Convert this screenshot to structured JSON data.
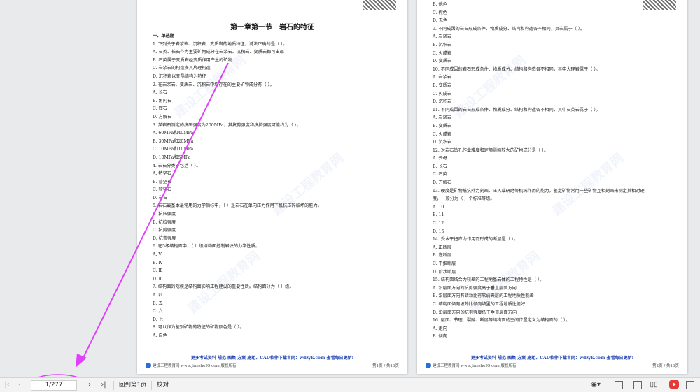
{
  "page1": {
    "title": "第一章第一节　岩石的特征",
    "lines": [
      "一、单选题",
      "1. 下列关于岩浆岩、沉积岩、变质岩的地质特征，说法正确的是（ ）。",
      "A. 石英、长石作为主要矿物成分在岩浆岩、沉积岩、变质岩都可出现",
      "B. 石英属于变质岩经变质作用产生的矿物",
      "C. 岩浆岩的构造多具片理构造",
      "D. 沉积岩以变晶结构为特征",
      "2. 在岩浆岩、变质岩、沉积岩中均存在的主要矿物成分有（ ）。",
      "A. 长石",
      "B. 角闪石",
      "C. 辉石",
      "D. 方解石",
      "3. 某岩石测定的抗压强度为200MPa，其抗剪强度和抗拉强度可能约为（ ）。",
      "A. 60MPa和40MPa",
      "B. 30MPa和20MPa",
      "C. 10MPa和10MPa",
      "D. 10MPa和5MPa",
      "4. 岩石分类不包括（ ）。",
      "A. 特坚石",
      "B. 普坚石",
      "C. 软坚石",
      "D. 岩石",
      "5. 岩石最基本最常用的力学指标中，（ ）是岩石在单向压力作用下抵抗压碎破坏的能力。",
      "A. 抗压强度",
      "B. 抗拉强度",
      "C. 抗剪强度",
      "D. 抗弯强度",
      "6. 在5级结构面中，（ ）级结构面控制岩块的力学性质。",
      "A. Ⅴ",
      "B. Ⅳ",
      "C. Ⅲ",
      "D. Ⅱ",
      "7. 结构面的规模是结构面影响工程建设的重要性质。结构面分为（ ）级。",
      "A. 四",
      "B. 五",
      "C. 六",
      "D. 七",
      "8. 可以作为鉴别矿物的特征的矿物颜色是（ ）。",
      "A. 自色"
    ],
    "footer_promo": "更多考试资料 规范 图集 方案 施组、CAD软件下载官网：wdzyk.com 查看每日更新!",
    "footer_left": "建设工程教育网 www.jianshe99.com 版权所有",
    "footer_right": "第1页 / 共16页"
  },
  "page2": {
    "lines": [
      "B. 他色",
      "C. 假色",
      "D. 无色",
      "9. 不同成因的岩石形成条件、物质成分、结构和构造各不相同，页岩属于（ ）。",
      "A. 岩浆岩",
      "B. 沉积岩",
      "C. 火成岩",
      "D. 变质岩",
      "10. 不同成因的岩石形成条件、物质成分、结构和构造各不相同，其中大理岩属于（ ）。",
      "A. 岩浆岩",
      "B. 变质岩",
      "C. 火成岩",
      "D. 沉积岩",
      "11. 不同成因的岩石形成条件、物质成分、结构和构造各不相同，其中石英岩属于（ ）。",
      "A. 岩浆岩",
      "B. 变质岩",
      "C. 火成岩",
      "D. 沉积岩",
      "12. 对岩石钻孔作业难度和定额影响较大的矿物成分是（ ）。",
      "A. 云母",
      "B. 长石",
      "C. 石英",
      "D. 方解石",
      "13. 硬度是矿物抵抗外力刻画、压入或研磨等机械作用的能力。鉴定矿物常用一些矿物互相刻画来测定其相对硬",
      "度，一般分为（ ）个标准等级。",
      "A. 10",
      "B. 11",
      "C. 12",
      "D. 15",
      "14. 受水平扭应力作用而形成的断层是（ ）。",
      "A. 正断层",
      "B. 逆断层",
      "C. 平推断层",
      "D. 阶状断层",
      "15. 结构面结合力较差的工程地基岩体的工程特性是（ ）。",
      "A. 沿层面方向的抗剪强度高于垂直层面方向",
      "B. 沿层面方向有错动比有软弱夹层的工程地质性能差",
      "C. 结构面倾向坡外比倾向坡里的工程地质性能好",
      "D. 沿层面方向的抗剪强度低于垂直层面方向",
      "16. 层面、节理、裂隙、断层等结构面的空间位置定义为结构面的（ ）。",
      "A. 走向",
      "B. 倾向"
    ],
    "footer_promo": "更多考试资料 规范 图集 方案 施组、CAD软件下载官网：wdzyk.com 查看每日更新!",
    "footer_left": "建设工程教育网 www.jianshe99.com 版权所有",
    "footer_right": "第2页 / 共16页"
  },
  "toolbar": {
    "first_page_icon": "first-page-icon",
    "prev_page_icon": "prev-page-icon",
    "page_indicator": "1/277",
    "next_page_icon": "next-page-icon",
    "last_page_icon": "last-page-icon",
    "goto_first_label": "回到第1页",
    "proofread_label": "校对"
  },
  "colors": {
    "annotation": "#e040fb",
    "promo_text": "#1a3fb0"
  }
}
